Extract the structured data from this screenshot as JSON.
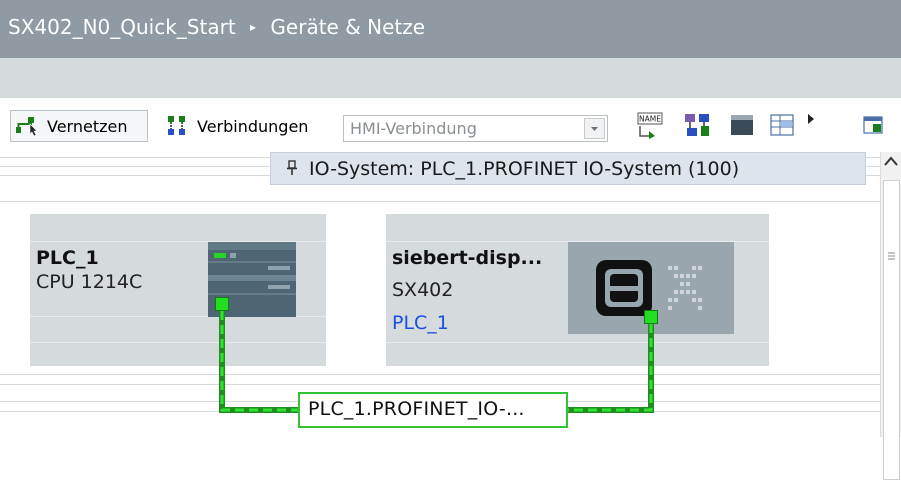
{
  "breadcrumb": {
    "project": "SX402_N0_Quick_Start",
    "separator": "▸",
    "current": "Geräte & Netze"
  },
  "toolbar": {
    "network_button": "Vernetzen",
    "connections_label": "Verbindungen",
    "connection_type": {
      "selected": "HMI-Verbindung"
    },
    "icons": [
      "network-icon",
      "connections-icon",
      "name-icon",
      "network-view-icon",
      "overview-icon",
      "table-icon",
      "more-arrow-icon",
      "panel-icon"
    ]
  },
  "io_system": {
    "label": "IO-System: PLC_1.PROFINET IO-System (100)"
  },
  "devices": [
    {
      "name": "PLC_1",
      "type": "CPU 1214C",
      "icon": "plc-module-icon"
    },
    {
      "name": "siebert-disp...",
      "type": "SX402",
      "controller_link": "PLC_1",
      "icon": "siebert-display-icon"
    }
  ],
  "network": {
    "label": "PLC_1.PROFINET_IO-...",
    "color": "#33c233"
  },
  "colors": {
    "title_bar": "#8f9aa2",
    "device_box": "#d5dadd",
    "port": "#22dd22",
    "link": "#1b4fe0"
  }
}
